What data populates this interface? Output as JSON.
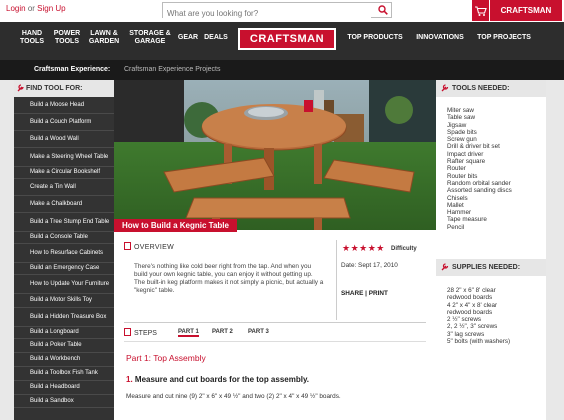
{
  "topbar": {
    "login": "Login",
    "or": "or",
    "signup": "Sign Up",
    "search_placeholder": "What are you looking for?",
    "club": "CRAFTSMAN CLUB"
  },
  "nav": {
    "items": [
      {
        "line1": "HAND",
        "line2": "TOOLS"
      },
      {
        "line1": "POWER",
        "line2": "TOOLS"
      },
      {
        "line1": "LAWN &",
        "line2": "GARDEN"
      },
      {
        "line1": "STORAGE &",
        "line2": "GARAGE"
      },
      {
        "line1": "GEAR",
        "line2": ""
      },
      {
        "line1": "DEALS",
        "line2": ""
      }
    ],
    "logo": "CRAFTSMAN",
    "right_items": [
      "TOP PRODUCTS",
      "INNOVATIONS",
      "TOP PROJECTS"
    ]
  },
  "breadcrumb": {
    "section": "Craftsman Experience:",
    "current": "Craftsman Experience Projects"
  },
  "left": {
    "heading": "FIND TOOL FOR:",
    "items": [
      "Build a Moose Head",
      "Build a Couch Platform",
      "Build a Wood Wall",
      "Make a Steering Wheel Table",
      "Make a Circular Bookshelf",
      "Create a Tin Wall",
      "Make a Chalkboard",
      "Build a Tree Stump End Table",
      "Build a Console Table",
      "How to Resurface Cabinets",
      "Build an Emergency Case",
      "How to Update Your Furniture",
      "Build a Motor Skills Toy",
      "Build a Hidden Treasure Box",
      "Build a Longboard",
      "Build a Poker Table",
      "Build a Workbench",
      "Build a Toolbox Fish Tank",
      "Build a Headboard",
      "Build a Sandbox"
    ]
  },
  "article": {
    "title": "How to Build a Kegnic Table",
    "overview_heading": "OVERVIEW",
    "overview_text": "There's nothing like cold beer right from the tap. And when you build your own kegnic table, you can enjoy it without getting up. The built-in keg platform makes it not simply a picnic, but actually a \"kegnic\" table.",
    "stars": "★★★★★",
    "rating": 5,
    "difficulty": "Difficulty",
    "date": "Date: Sept 17, 2010",
    "share": "SHARE | PRINT",
    "steps_heading": "STEPS",
    "tabs": [
      "PART 1",
      "PART 2",
      "PART 3"
    ],
    "part_title": "Part 1: Top Assembly",
    "step_number": "1.",
    "step_title": "Measure and cut boards for the top assembly.",
    "step_text": "Measure and cut nine (9) 2\" x 6\" x 49 ½\" and two (2) 2\" x 4\" x 49 ½\" boards."
  },
  "right": {
    "tools_heading": "TOOLS NEEDED:",
    "tools": [
      "Miter saw",
      "Table saw",
      "Jigsaw",
      "Spade bits",
      "Screw gun",
      "Drill & driver bit set",
      "Impact driver",
      "Rafter square",
      "Router",
      "Router bits",
      "Random orbital sander",
      "Assorted sanding discs",
      "Chisels",
      "Mallet",
      "Hammer",
      "Tape measure",
      "Pencil"
    ],
    "supplies_heading": "SUPPLIES NEEDED:",
    "supplies": [
      "28 2\" x 6\" 8' clear",
      "redwood boards",
      "4 2\" x 4\" x 8' clear",
      "redwood boards",
      "2 ½\" screws",
      "2, 2 ½\", 3\" screws",
      "3\" lag screws",
      "5\" bolts (with washers)"
    ]
  },
  "colors": {
    "brand_red": "#c8102e",
    "nav_bg": "#2d2d2d",
    "sidebar_bg": "#333333"
  }
}
